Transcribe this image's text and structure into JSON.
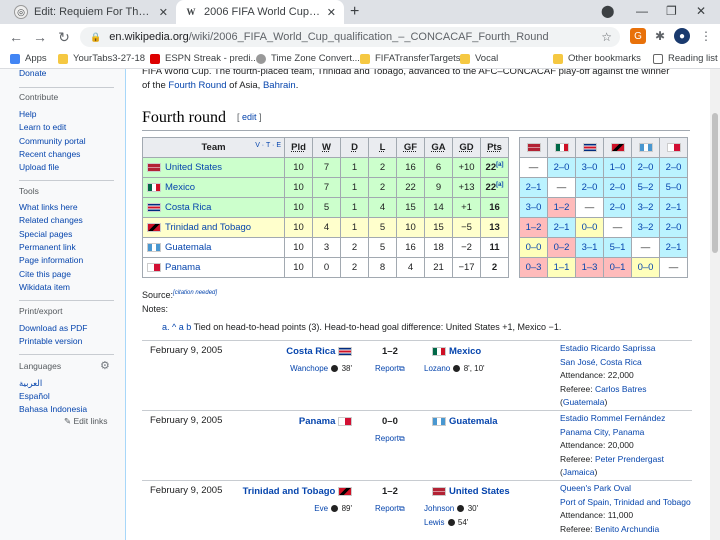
{
  "browser": {
    "tabs": [
      {
        "title": "Edit: Requiem For The CONCACAF",
        "active": false
      },
      {
        "title": "2006 FIFA World Cup qualificatio",
        "active": true
      }
    ],
    "url_host": "en.wikipedia.org",
    "url_path": "/wiki/2006_FIFA_World_Cup_qualification_–_CONCACAF_Fourth_Round",
    "bookmarks": [
      "Apps",
      "YourTabs3-27-18",
      "ESPN Streak - predi...",
      "Time Zone Convert...",
      "FIFATransferTargets",
      "Vocal",
      "Other bookmarks",
      "Reading list"
    ]
  },
  "sidebar": {
    "cut_item": "Donate",
    "contribute_heading": "Contribute",
    "contribute": [
      "Help",
      "Learn to edit",
      "Community portal",
      "Recent changes",
      "Upload file"
    ],
    "tools_heading": "Tools",
    "tools": [
      "What links here",
      "Related changes",
      "Special pages",
      "Permanent link",
      "Page information",
      "Cite this page",
      "Wikidata item"
    ],
    "print_heading": "Print/export",
    "print": [
      "Download as PDF",
      "Printable version"
    ],
    "languages_heading": "Languages",
    "languages": [
      "العربية",
      "Español",
      "Bahasa Indonesia"
    ],
    "edit_links": "Edit links"
  },
  "article": {
    "intro_line1": "FIFA World Cup. The fourth-placed team, Trinidad and Tobago, advanced to the AFC–CONCACAF play-off against the winner",
    "intro_line2_pre": "of the ",
    "intro_link1": "Fourth Round",
    "intro_mid": " of Asia, ",
    "intro_link2": "Bahrain",
    "intro_end": ".",
    "section_title": "Fourth round",
    "edit_link": "edit",
    "vte": "V · T · E",
    "headers": [
      "Team",
      "Pld",
      "W",
      "D",
      "L",
      "GF",
      "GA",
      "GD",
      "Pts"
    ],
    "rows": [
      {
        "team": "United States",
        "pld": "10",
        "w": "7",
        "d": "1",
        "l": "2",
        "gf": "16",
        "ga": "6",
        "gd": "+10",
        "pts": "22",
        "note": "[a]"
      },
      {
        "team": "Mexico",
        "pld": "10",
        "w": "7",
        "d": "1",
        "l": "2",
        "gf": "22",
        "ga": "9",
        "gd": "+13",
        "pts": "22",
        "note": "[a]"
      },
      {
        "team": "Costa Rica",
        "pld": "10",
        "w": "5",
        "d": "1",
        "l": "4",
        "gf": "15",
        "ga": "14",
        "gd": "+1",
        "pts": "16",
        "note": ""
      },
      {
        "team": "Trinidad and Tobago",
        "pld": "10",
        "w": "4",
        "d": "1",
        "l": "5",
        "gf": "10",
        "ga": "15",
        "gd": "−5",
        "pts": "13",
        "note": ""
      },
      {
        "team": "Guatemala",
        "pld": "10",
        "w": "3",
        "d": "2",
        "l": "5",
        "gf": "16",
        "ga": "18",
        "gd": "−2",
        "pts": "11",
        "note": ""
      },
      {
        "team": "Panama",
        "pld": "10",
        "w": "0",
        "d": "2",
        "l": "8",
        "gf": "4",
        "ga": "21",
        "gd": "−17",
        "pts": "2",
        "note": ""
      }
    ],
    "results": [
      [
        "—",
        "2–0",
        "3–0",
        "1–0",
        "2–0",
        "2–0"
      ],
      [
        "2–1",
        "—",
        "2–0",
        "2–0",
        "5–2",
        "5–0"
      ],
      [
        "3–0",
        "1–2",
        "—",
        "2–0",
        "3–2",
        "2–1"
      ],
      [
        "1–2",
        "2–1",
        "0–0",
        "—",
        "3–2",
        "2–0"
      ],
      [
        "0–0",
        "0–2",
        "3–1",
        "5–1",
        "—",
        "2–1"
      ],
      [
        "0–3",
        "1–1",
        "1–3",
        "0–1",
        "0–0",
        "—"
      ]
    ],
    "source_label": "Source:",
    "source_cn": "[citation needed]",
    "notes_label": "Notes:",
    "note_a_prefix": "a. ^ a b",
    "note_a_text": "Tied on head-to-head points (3). Head-to-head goal difference: United States +1, Mexico −1.",
    "matches": [
      {
        "date": "February 9, 2005",
        "home": "Costa Rica",
        "score": "1–2",
        "away": "Mexico",
        "home_scorers": "Wanchope",
        "home_min": "38'",
        "away_scorers": "Lozano",
        "away_min": "8', 10'",
        "report": "Report",
        "venue": "Estadio Ricardo Saprissa",
        "city": "San José, Costa Rica",
        "attendance": "Attendance: 22,000",
        "referee_label": "Referee: ",
        "referee": "Carlos Batres",
        "ref_country": "(Guatemala)"
      },
      {
        "date": "February 9, 2005",
        "home": "Panama",
        "score": "0–0",
        "away": "Guatemala",
        "home_scorers": "",
        "home_min": "",
        "away_scorers": "",
        "away_min": "",
        "report": "Report",
        "venue": "Estadio Rommel Fernández",
        "city": "Panama City, Panama",
        "attendance": "Attendance: 20,000",
        "referee_label": "Referee: ",
        "referee": "Peter Prendergast",
        "ref_country": "(Jamaica)"
      },
      {
        "date": "February 9, 2005",
        "home": "Trinidad and Tobago",
        "score": "1–2",
        "away": "United States",
        "home_scorers": "Eve",
        "home_min": "89'",
        "away_scorers": "Johnson",
        "away_min": "30'",
        "away_scorers2": "Lewis",
        "away_min2": "54'",
        "report": "Report",
        "venue": "Queen's Park Oval",
        "city": "Port of Spain, Trinidad and Tobago",
        "attendance": "Attendance: 11,000",
        "referee_label": "Referee: ",
        "referee": "Benito Archundia"
      }
    ]
  }
}
